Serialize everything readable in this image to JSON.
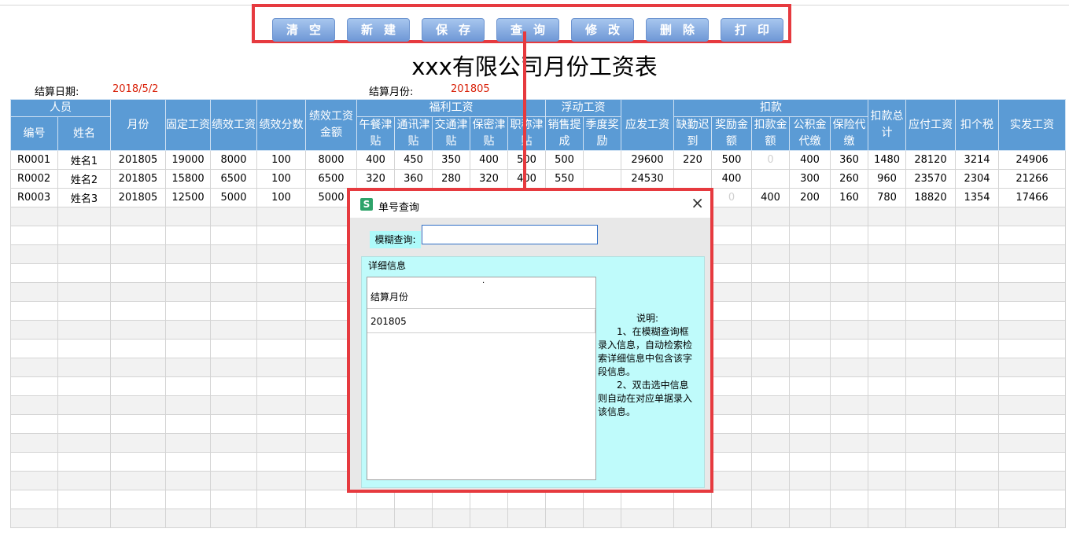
{
  "toolbar": {
    "buttons": [
      "清空",
      "新建",
      "保存",
      "查询",
      "修改",
      "删除",
      "打印"
    ]
  },
  "title": "xxx有限公司月份工资表",
  "info": {
    "settle_date_label": "结算日期:",
    "settle_date_value": "2018/5/2",
    "settle_month_label": "结算月份:",
    "settle_month_value": "201805"
  },
  "table": {
    "group_person": "人员",
    "group_welfare": "福利工资",
    "group_float": "浮动工资",
    "group_deduct": "扣款",
    "col_id": "编号",
    "col_name": "姓名",
    "col_month": "月份",
    "col_fixed": "固定工资",
    "col_perf": "绩效工资",
    "col_perf_score": "绩效分数",
    "col_perf_amount": "绩效工资金额",
    "col_lunch": "午餐津贴",
    "col_comm": "通讯津贴",
    "col_transport": "交通津贴",
    "col_secret": "保密津贴",
    "col_title": "职称津贴",
    "col_sales": "销售提成",
    "col_season": "季度奖励",
    "col_gross": "应发工资",
    "col_absent": "缺勤迟到",
    "col_bonus": "奖励金额",
    "col_fine": "扣款金额",
    "col_fund": "公积金代缴",
    "col_insurance": "保险代缴",
    "col_deduct_total": "扣款总计",
    "col_payable": "应付工资",
    "col_tax": "扣个税",
    "col_net": "实发工资",
    "rows": [
      {
        "id": "R0001",
        "name": "姓名1",
        "month": "201805",
        "fixed": "19000",
        "perf": "8000",
        "score": "100",
        "perf_amt": "8000",
        "lunch": "400",
        "comm": "450",
        "transport": "350",
        "secret": "400",
        "title_a": "500",
        "sales": "500",
        "season": "",
        "gross": "29600",
        "absent": "220",
        "bonus": "500",
        "fine": "0",
        "fund": "400",
        "insurance": "360",
        "deduct_total": "1480",
        "payable": "28120",
        "tax": "3214",
        "net": "24906"
      },
      {
        "id": "R0002",
        "name": "姓名2",
        "month": "201805",
        "fixed": "15800",
        "perf": "6500",
        "score": "100",
        "perf_amt": "6500",
        "lunch": "320",
        "comm": "360",
        "transport": "280",
        "secret": "320",
        "title_a": "400",
        "sales": "550",
        "season": "",
        "gross": "24530",
        "absent": "",
        "bonus": "400",
        "fine": "",
        "fund": "300",
        "insurance": "260",
        "deduct_total": "960",
        "payable": "23570",
        "tax": "2304",
        "net": "21266"
      },
      {
        "id": "R0003",
        "name": "姓名3",
        "month": "201805",
        "fixed": "12500",
        "perf": "5000",
        "score": "100",
        "perf_amt": "5000",
        "lunch": "",
        "comm": "",
        "transport": "",
        "secret": "",
        "title_a": "",
        "sales": "",
        "season": "",
        "gross": "",
        "absent": "",
        "bonus": "0",
        "fine": "400",
        "fund": "200",
        "insurance": "160",
        "deduct_total": "780",
        "payable": "18820",
        "tax": "1354",
        "net": "17466"
      }
    ]
  },
  "dialog": {
    "icon_letter": "S",
    "title": "单号查询",
    "close": "×",
    "fuzzy_label": "模糊查询:",
    "fuzzy_value": "",
    "detail_legend": "详细信息",
    "list_dot": "·",
    "list_header": "结算月份",
    "list_value": "201805",
    "note_title": "说明:",
    "note_1": "1、在模糊查询框录入信息，自动检索检索详细信息中包含该字段信息。",
    "note_2": "2、双击选中信息则自动在对应单据录入该信息。"
  },
  "colors": {
    "header_blue": "#5b9bd5",
    "highlight_red": "#e63a3f",
    "date_red": "#d81e06",
    "dialog_cyan": "#bffbfb"
  }
}
